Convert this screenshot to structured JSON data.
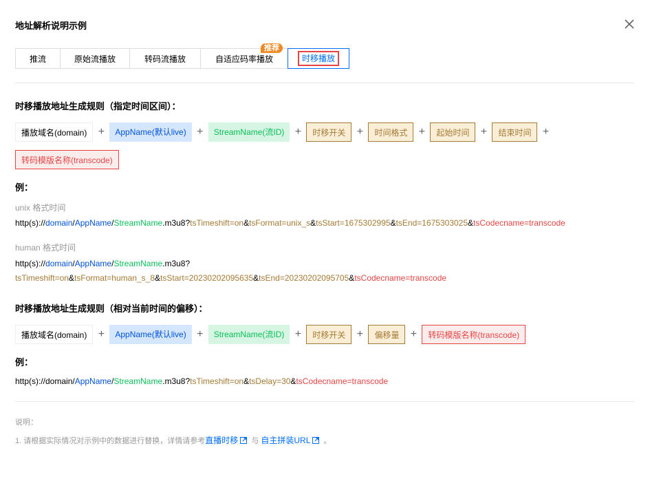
{
  "dialog": {
    "title": "地址解析说明示例"
  },
  "tabs": [
    {
      "label": "推流"
    },
    {
      "label": "原始流播放"
    },
    {
      "label": "转码流播放"
    },
    {
      "label": "自适应码率播放"
    },
    {
      "label": "时移播放"
    }
  ],
  "badge": "推荐",
  "rule1": {
    "heading": "时移播放地址生成规则（指定时间区间）：",
    "chips": [
      "播放域名(domain)",
      "AppName(默认live)",
      "StreamName(流ID)",
      "时移开关",
      "时间格式",
      "起始时间",
      "结束时间",
      "转码模版名称(transcode)"
    ],
    "plus": "+"
  },
  "example1": {
    "label": "例：",
    "unix_label": "unix 格式时间",
    "unix_url": {
      "p1": "http(s)://",
      "domain": "domain",
      "s1": "/",
      "app": "AppName",
      "s2": "/",
      "stream": "StreamName",
      "ext": ".m3u8?",
      "shift": "tsTimeshift=on",
      "a1": "&",
      "fmt": "tsFormat=unix_s",
      "a2": "&",
      "start": "tsStart=1675302995",
      "a3": "&",
      "end": "tsEnd=1675303025",
      "a4": "&",
      "code": "tsCodecname=transcode"
    },
    "human_label": "human 格式时间",
    "human_url_line1": {
      "p1": "http(s)://",
      "domain": "domain",
      "s1": "/",
      "app": "AppName",
      "s2": "/",
      "stream": "StreamName",
      "ext": ".m3u8?"
    },
    "human_url_line2": {
      "shift": "tsTimeshift=on",
      "a1": "&",
      "fmt": "tsFormat=human_s_8",
      "a2": "&",
      "start": "tsStart=20230202095635",
      "a3": "&",
      "end": "tsEnd=20230202095705",
      "a4": "&",
      "code": "tsCodecname=transcode"
    }
  },
  "rule2": {
    "heading": "时移播放地址生成规则（相对当前时间的偏移）：",
    "chips": [
      "播放域名(domain)",
      "AppName(默认live)",
      "StreamName(流ID)",
      "时移开关",
      "偏移量",
      "转码模版名称(transcode)"
    ]
  },
  "example2": {
    "label": "例：",
    "url": {
      "p1": "http(s)://domain/",
      "app": "AppName",
      "s2": "/",
      "stream": "StreamName",
      "ext": ".m3u8?",
      "shift": "tsTimeshift=on",
      "a1": "&",
      "delay": "tsDelay=30",
      "a2": "&",
      "code": "tsCodecname=transcode"
    }
  },
  "notes": {
    "label": "说明：",
    "text1": "1. 请根据实际情况对示例中的数据进行替换，详情请参考",
    "link1": "直播时移",
    "mid": "与",
    "link2": "自主拼装URL",
    "end": "。"
  },
  "icons": {
    "close": "close-icon",
    "external": "external-link-icon"
  }
}
